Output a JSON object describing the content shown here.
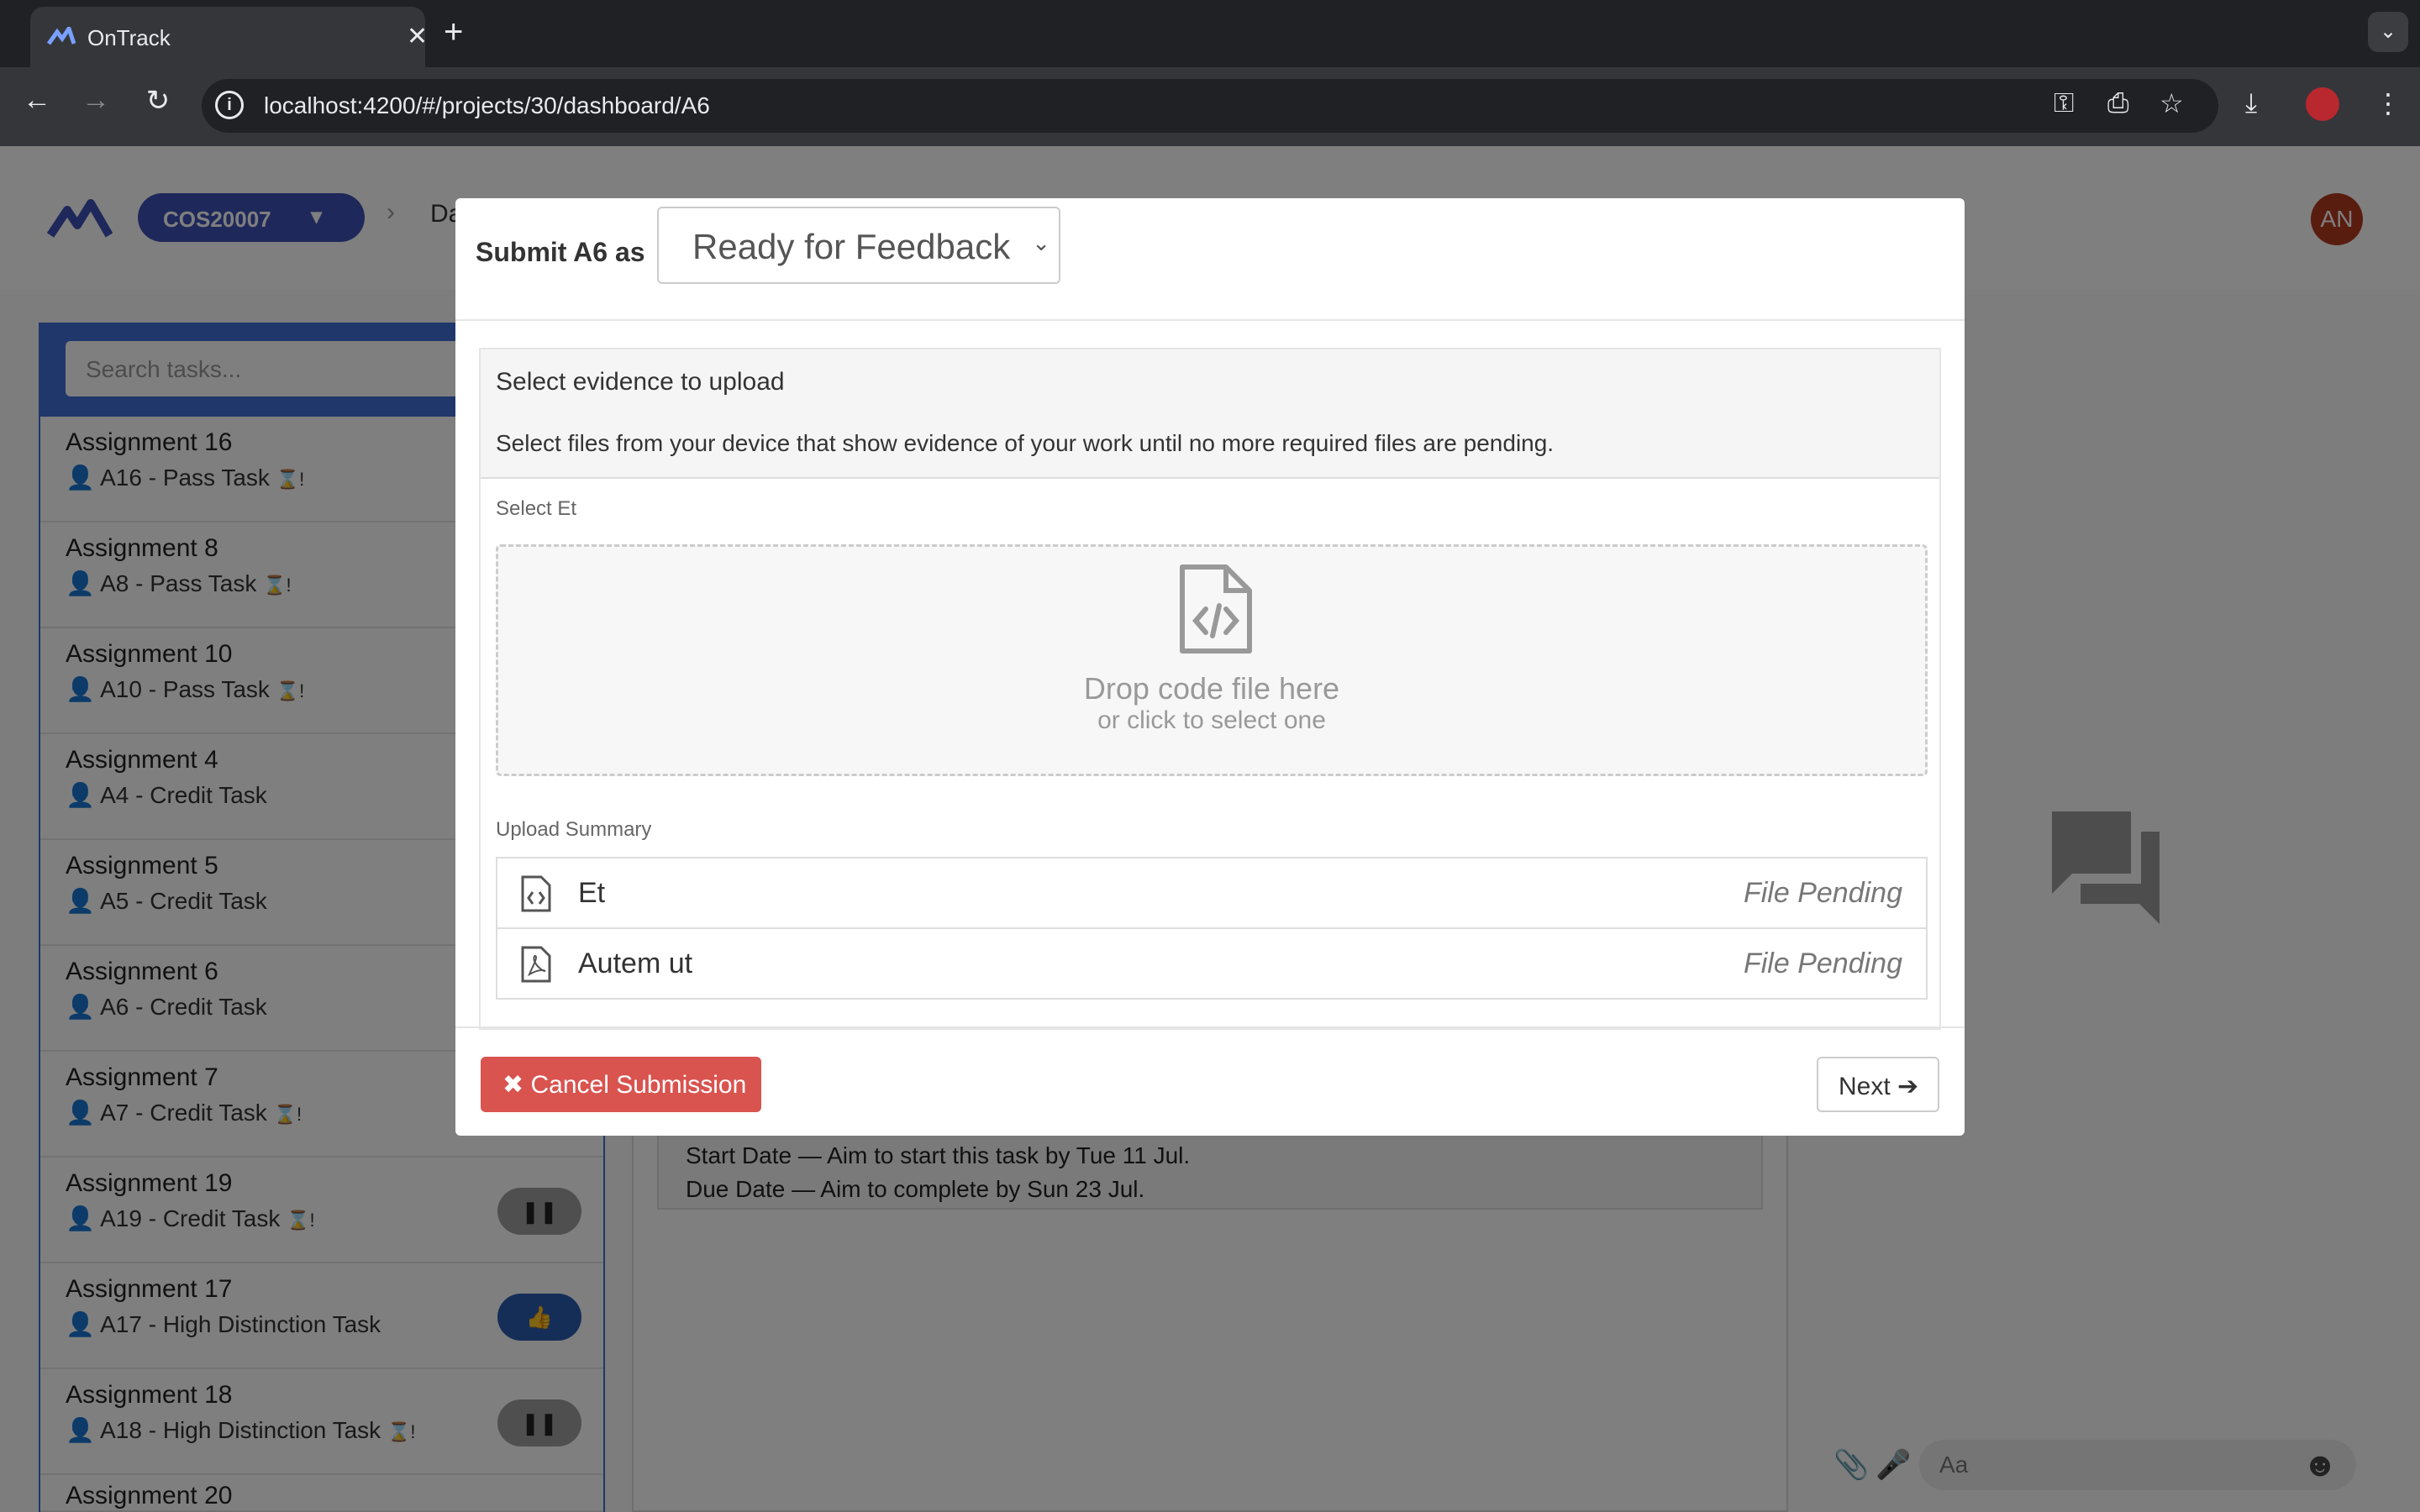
{
  "browser": {
    "tab_title": "OnTrack",
    "url": "localhost:4200/#/projects/30/dashboard/A6",
    "new_tab": "+",
    "close_tab": "✕"
  },
  "app": {
    "unit_code": "COS20007",
    "breadcrumb_partial": "Da",
    "avatar_initials": "AN",
    "search_placeholder": "Search tasks...",
    "tasks": [
      {
        "name": "Assignment 16",
        "sub": "A16 - Pass Task",
        "flag": "⌛!"
      },
      {
        "name": "Assignment 8",
        "sub": "A8 - Pass Task",
        "flag": "⌛!"
      },
      {
        "name": "Assignment 10",
        "sub": "A10 - Pass Task",
        "flag": "⌛!"
      },
      {
        "name": "Assignment 4",
        "sub": "A4 - Credit Task",
        "flag": ""
      },
      {
        "name": "Assignment 5",
        "sub": "A5 - Credit Task",
        "flag": ""
      },
      {
        "name": "Assignment 6",
        "sub": "A6 - Credit Task",
        "flag": ""
      },
      {
        "name": "Assignment 7",
        "sub": "A7 - Credit Task",
        "flag": "⌛!"
      },
      {
        "name": "Assignment 19",
        "sub": "A19 - Credit Task",
        "flag": "⌛!"
      },
      {
        "name": "Assignment 17",
        "sub": "A17 - High Distinction Task",
        "flag": ""
      },
      {
        "name": "Assignment 18",
        "sub": "A18 - High Distinction Task",
        "flag": "⌛!"
      },
      {
        "name": "Assignment 20",
        "sub": "",
        "flag": ""
      }
    ],
    "start_date_text": "Start Date — Aim to start this task by Tue 11 Jul.",
    "due_date_text": "Due Date — Aim to complete by Sun 23 Jul.",
    "chat_placeholder": "Aa"
  },
  "modal": {
    "submit_label": "Submit A6 as",
    "status_selected": "Ready for Feedback",
    "panel_title": "Select evidence to upload",
    "panel_desc": "Select files from your device that show evidence of your work until no more required files are pending.",
    "select_label": "Select Et",
    "drop_title": "Drop code file here",
    "drop_sub": "or click to select one",
    "summary_label": "Upload Summary",
    "files": [
      {
        "name": "Et",
        "status": "File Pending",
        "icon": "code-file-icon"
      },
      {
        "name": "Autem ut",
        "status": "File Pending",
        "icon": "pdf-file-icon"
      }
    ],
    "cancel_label": "Cancel Submission",
    "next_label": "Next",
    "cancel_color": "#d9534f"
  }
}
